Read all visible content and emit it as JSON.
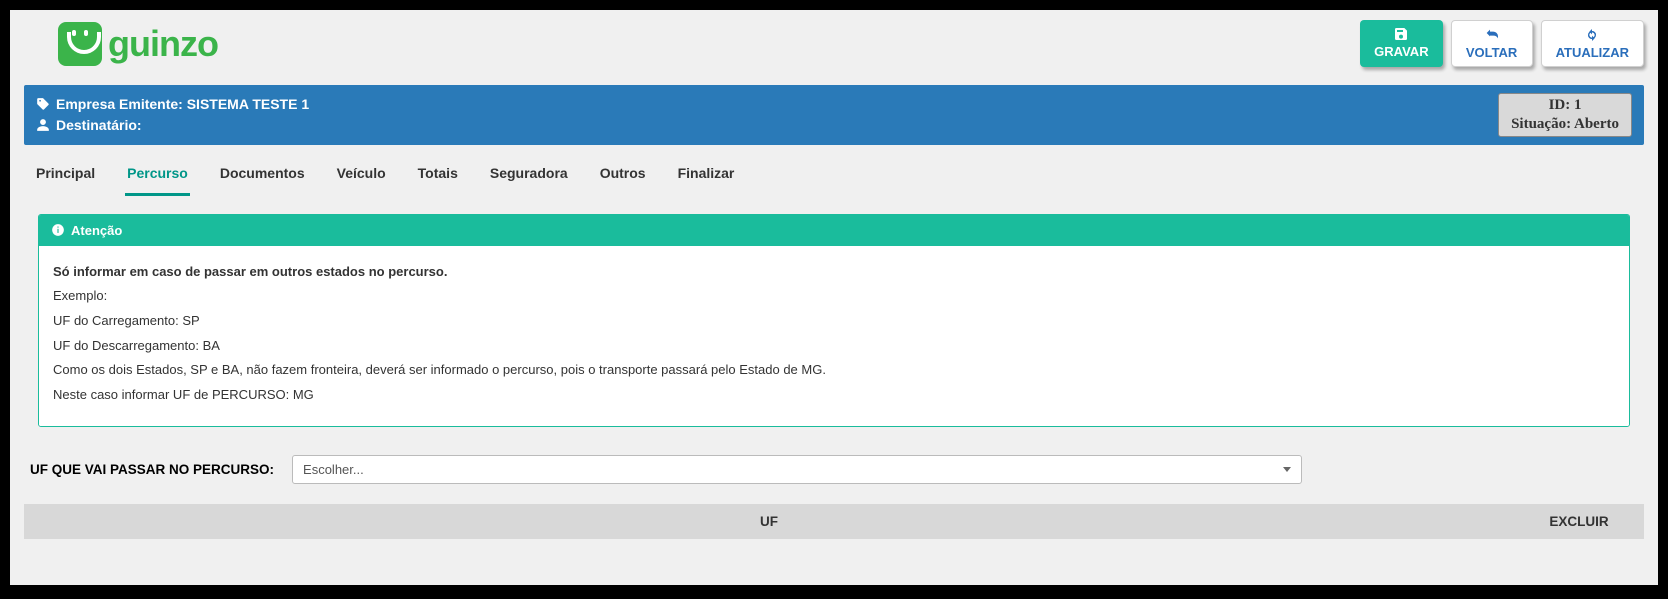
{
  "logo": {
    "text": "guinzo"
  },
  "actions": {
    "gravar": "GRAVAR",
    "voltar": "VOLTAR",
    "atualizar": "ATUALIZAR"
  },
  "header": {
    "empresa_label": "Empresa Emitente:",
    "empresa_value": "SISTEMA TESTE 1",
    "destinatario_label": "Destinatário:",
    "destinatario_value": "",
    "id_label": "ID:",
    "id_value": "1",
    "situacao_label": "Situação:",
    "situacao_value": "Aberto"
  },
  "tabs": [
    {
      "label": "Principal",
      "key": "principal",
      "active": false
    },
    {
      "label": "Percurso",
      "key": "percurso",
      "active": true
    },
    {
      "label": "Documentos",
      "key": "documentos",
      "active": false
    },
    {
      "label": "Veículo",
      "key": "veiculo",
      "active": false
    },
    {
      "label": "Totais",
      "key": "totais",
      "active": false
    },
    {
      "label": "Seguradora",
      "key": "seguradora",
      "active": false
    },
    {
      "label": "Outros",
      "key": "outros",
      "active": false
    },
    {
      "label": "Finalizar",
      "key": "finalizar",
      "active": false
    }
  ],
  "alert": {
    "title": "Atenção",
    "line1": "Só informar em caso de passar em outros estados no percurso.",
    "line2": "Exemplo:",
    "line3": "UF do Carregamento: SP",
    "line4": "UF do Descarregamento: BA",
    "line5": "Como os dois Estados, SP e BA, não fazem fronteira, deverá ser informado o percurso, pois o transporte passará pelo Estado de MG.",
    "line6": "Neste caso informar UF de PERCURSO: MG"
  },
  "form": {
    "uf_percurso_label": "UF QUE VAI PASSAR NO PERCURSO:",
    "uf_select_placeholder": "Escolher..."
  },
  "table": {
    "col_uf": "UF",
    "col_excluir": "EXCLUIR"
  }
}
